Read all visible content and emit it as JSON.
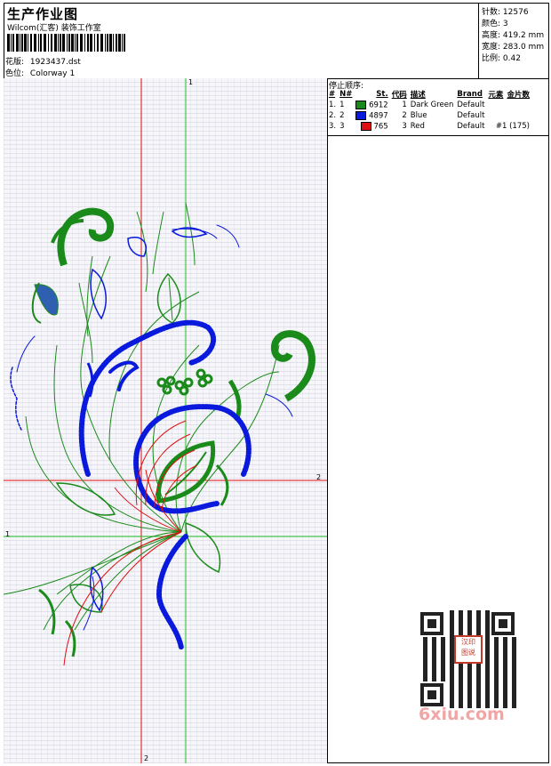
{
  "header": {
    "title": "生产作业图",
    "studio": "Wilcom(汇客) 装饰工作室",
    "design_label": "花版:",
    "design_value": "1923437.dst",
    "colorway_label": "色位:",
    "colorway_value": "Colorway 1"
  },
  "stats": [
    {
      "label": "针数:",
      "value": "12576"
    },
    {
      "label": "颜色:",
      "value": "3"
    },
    {
      "label": "高度:",
      "value": "419.2 mm"
    },
    {
      "label": "宽度:",
      "value": "283.0 mm"
    },
    {
      "label": "比例:",
      "value": "0.42"
    }
  ],
  "stop_sequence": {
    "title": "停止顺序:",
    "columns": [
      "#",
      "N#",
      "St.",
      "代码",
      "描述",
      "Brand",
      "元素",
      "金片数"
    ],
    "rows": [
      {
        "num": "1.",
        "n": "1",
        "color": "#1a8a1a",
        "st": "6912",
        "code": "1",
        "desc": "Dark Green",
        "brand": "Default",
        "element": "",
        "sequins": ""
      },
      {
        "num": "2.",
        "n": "2",
        "color": "#0a1adc",
        "st": "4897",
        "code": "2",
        "desc": "Blue",
        "brand": "Default",
        "element": "",
        "sequins": ""
      },
      {
        "num": "3.",
        "n": "3",
        "color": "#e01010",
        "st": "765",
        "code": "3",
        "desc": "Red",
        "brand": "Default",
        "element": "#1 (175)",
        "sequins": ""
      }
    ]
  },
  "guides": {
    "green_v_top": "1",
    "green_h_left": "1",
    "red_h_right": "2",
    "red_v_bottom": "2"
  },
  "watermark": {
    "text": "6xiu.com",
    "stamp": "汉印图说"
  }
}
